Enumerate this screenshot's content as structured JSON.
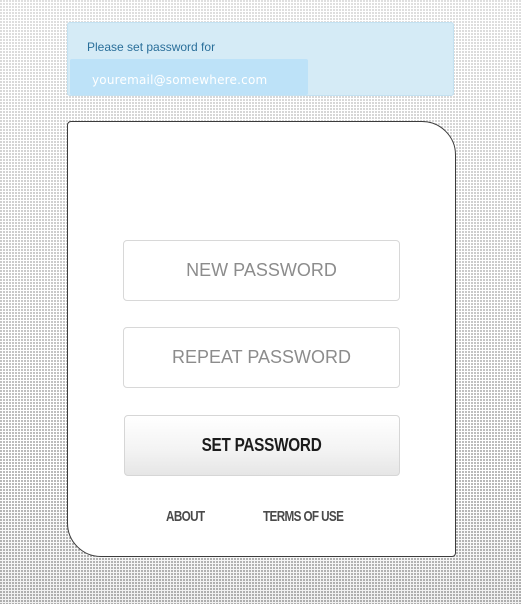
{
  "notice": {
    "label": "Please set password for",
    "email": "youremail@somewhere.com",
    "colors": {
      "background": "#d5ebf6",
      "chip": "#bde2f8",
      "label_text": "#2a6f9a"
    }
  },
  "form": {
    "new_password_placeholder": "NEW PASSWORD",
    "repeat_password_placeholder": "REPEAT PASSWORD",
    "new_password_value": "",
    "repeat_password_value": "",
    "submit_label": "SET PASSWORD"
  },
  "footer": {
    "about_label": "ABOUT",
    "terms_label": "TERMS OF USE"
  }
}
